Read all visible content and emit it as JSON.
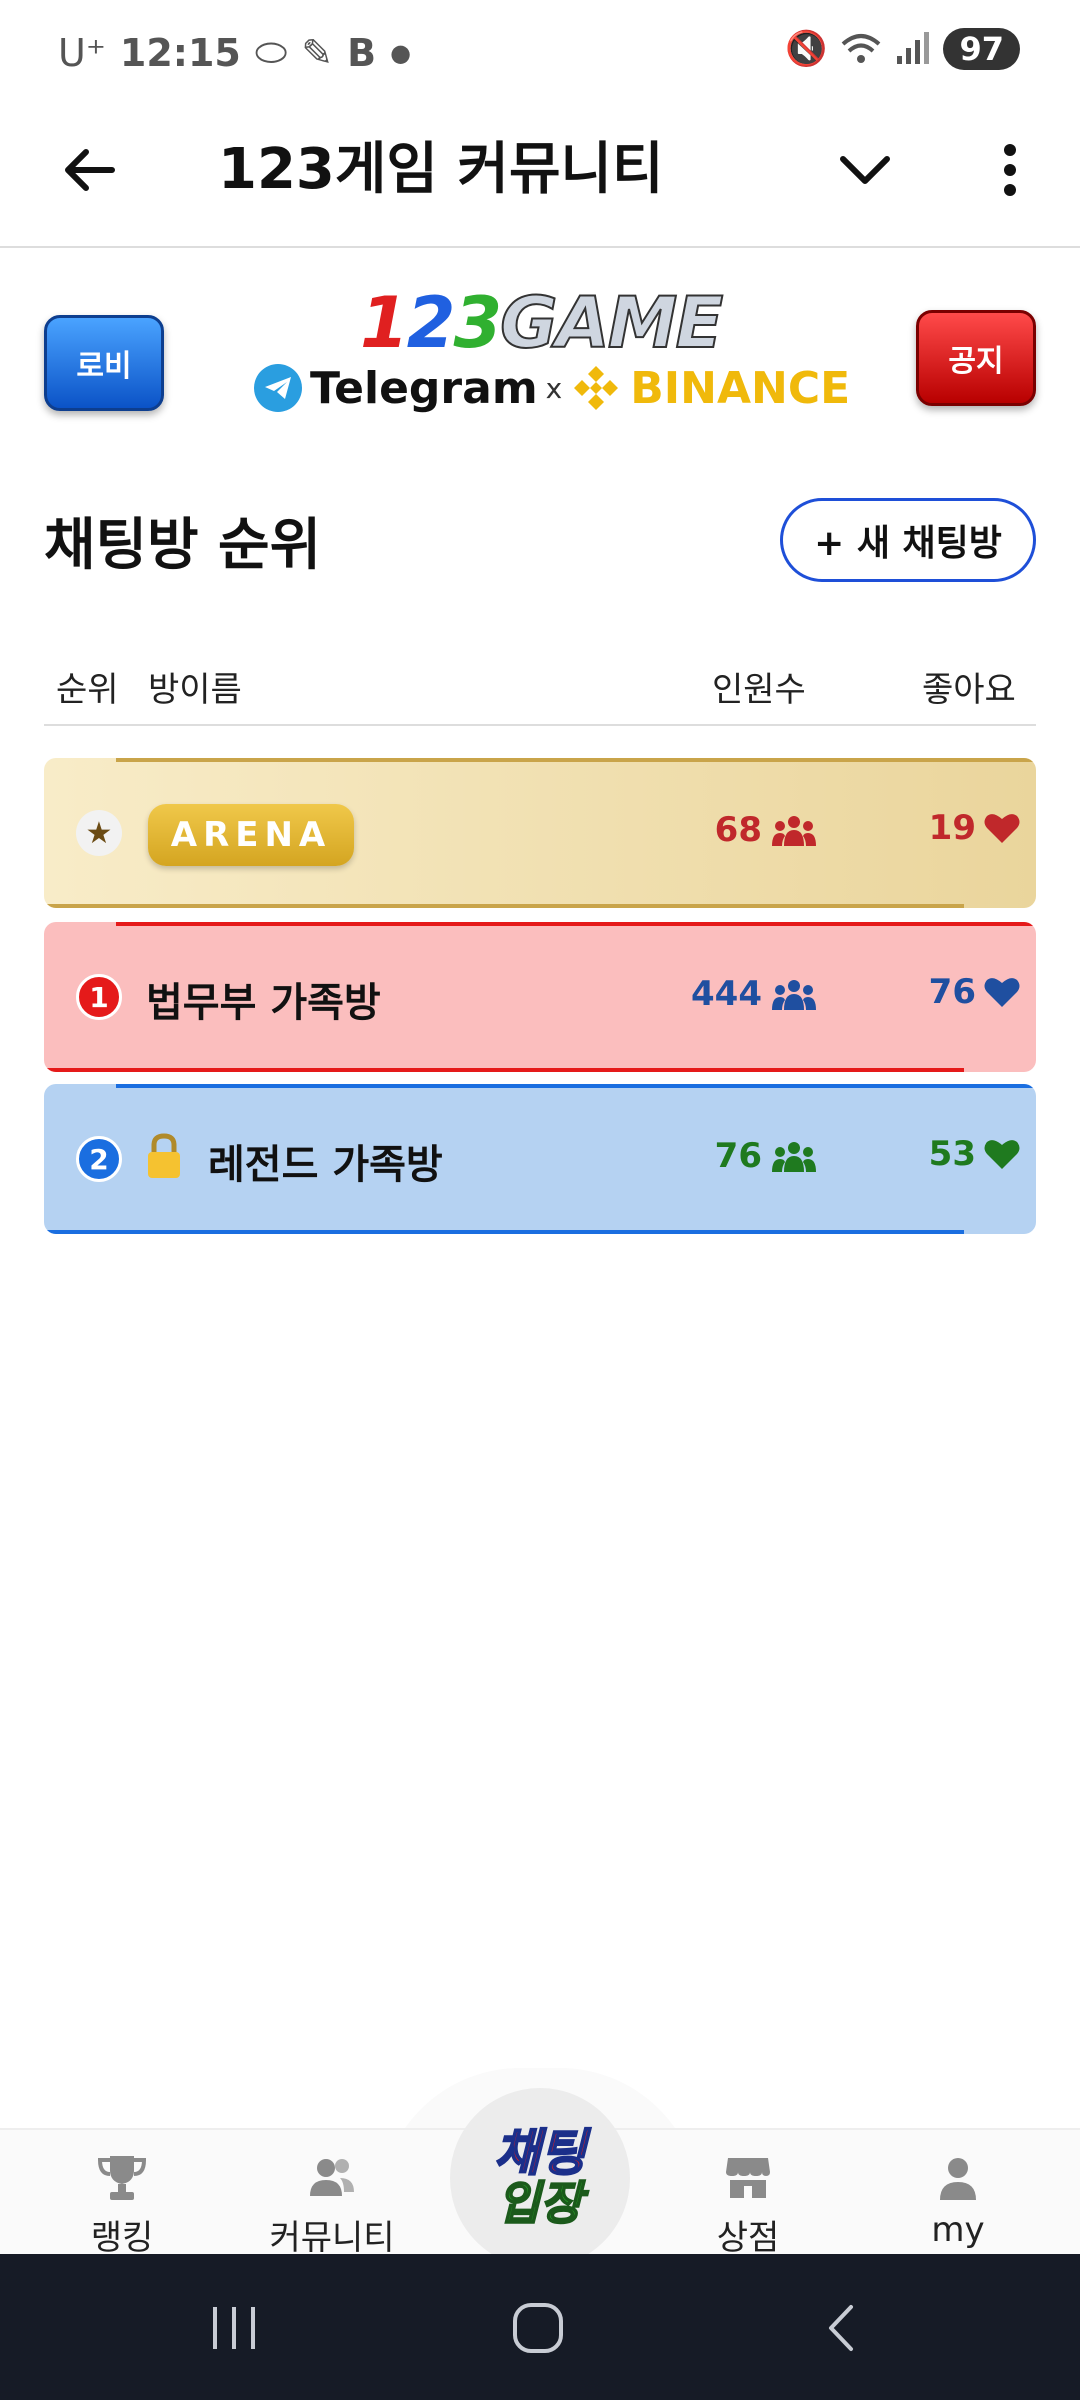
{
  "status_bar": {
    "carrier": "U⁺",
    "time": "12:15",
    "battery": "97"
  },
  "app_bar": {
    "title": "123게임 커뮤니티"
  },
  "banner": {
    "lobby_label": "로비",
    "notice_label": "공지",
    "logo_n1": "1",
    "logo_n2": "2",
    "logo_n3": "3",
    "logo_game": "GAME",
    "telegram": "Telegram",
    "times": "x",
    "binance": "BINANCE"
  },
  "section": {
    "title": "채팅방 순위",
    "new_room_button": "+ 새 채팅방"
  },
  "table_header": {
    "rank": "순위",
    "name": "방이름",
    "members": "인원수",
    "likes": "좋아요"
  },
  "rooms": [
    {
      "rank": "★",
      "name": "ARENA",
      "members": "68",
      "likes": "19",
      "accent": "#c0282b"
    },
    {
      "rank": "1",
      "name": "법무부 가족방",
      "members": "444",
      "likes": "76",
      "accent": "#1f4fa0"
    },
    {
      "rank": "2",
      "name": "레전드 가족방",
      "members": "76",
      "likes": "53",
      "accent": "#1f7a1f",
      "locked": true
    }
  ],
  "bottom_nav": {
    "ranking": "랭킹",
    "community": "커뮤니티",
    "chat_enter_top": "채팅",
    "chat_enter_bottom": "입장",
    "shop": "상점",
    "my": "my"
  }
}
